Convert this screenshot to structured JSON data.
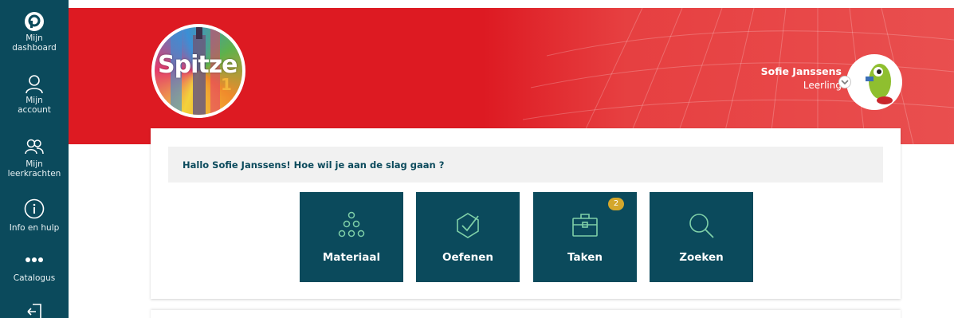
{
  "sidebar": {
    "items": [
      {
        "label": "Mijn dashboard",
        "icon": "pelckmans-logo-icon"
      },
      {
        "label": "Mijn account",
        "icon": "user-icon"
      },
      {
        "label": "Mijn leerkrachten",
        "icon": "users-icon"
      },
      {
        "label": "Info en hulp",
        "icon": "info-icon"
      },
      {
        "label": "Catalogus",
        "icon": "dots-icon"
      },
      {
        "label": "",
        "icon": "logout-icon"
      }
    ]
  },
  "header": {
    "logo_text": "Spitze",
    "logo_number": "1",
    "user_name": "Sofie Janssens",
    "user_role": "Leerling"
  },
  "main": {
    "greeting": "Hallo Sofie Janssens! Hoe wil je aan de slag gaan ?",
    "tiles": [
      {
        "label": "Materiaal",
        "icon": "molecule-icon"
      },
      {
        "label": "Oefenen",
        "icon": "check-shield-icon"
      },
      {
        "label": "Taken",
        "icon": "briefcase-icon",
        "badge": "2"
      },
      {
        "label": "Zoeken",
        "icon": "search-icon"
      }
    ]
  },
  "colors": {
    "sidebar": "#0b4a5c",
    "banner": "#dd1a22",
    "tile": "#0b4a5c",
    "tile_icon": "#7fd0a8",
    "badge": "#d4a72c"
  }
}
